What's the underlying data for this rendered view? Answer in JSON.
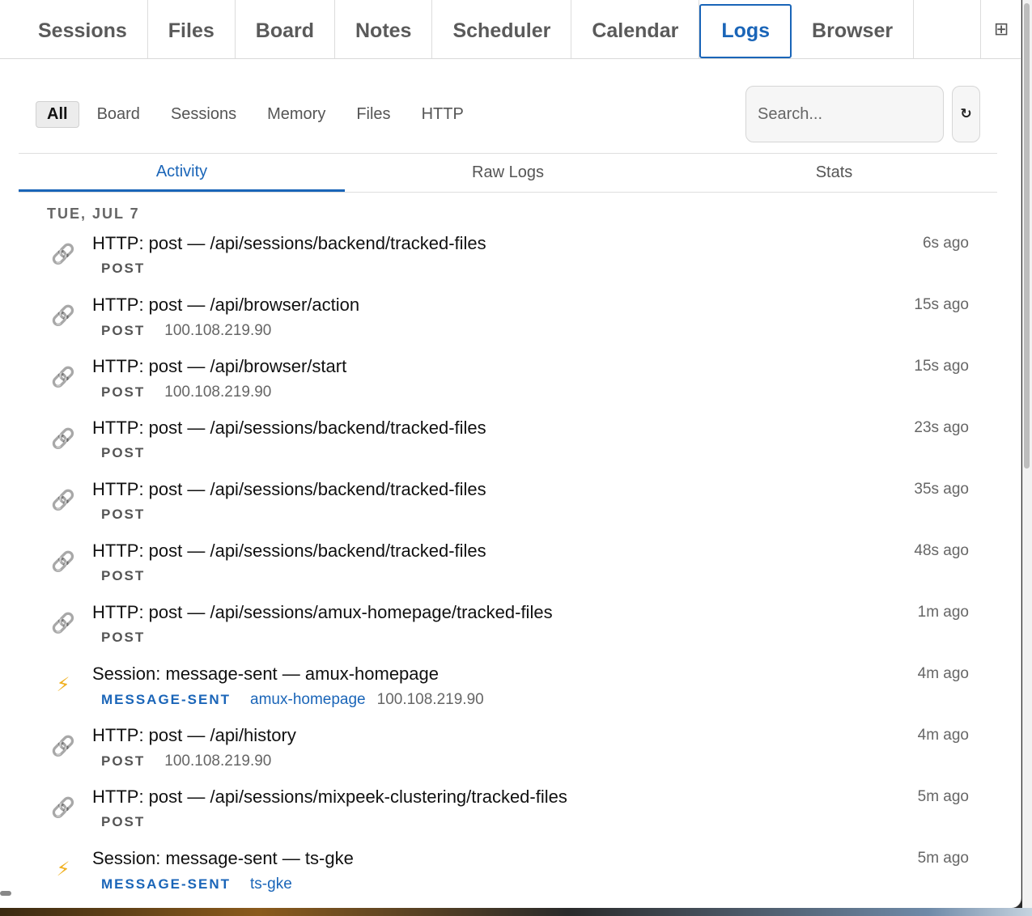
{
  "tabs": [
    {
      "label": "Sessions",
      "active": false
    },
    {
      "label": "Files",
      "active": false
    },
    {
      "label": "Board",
      "active": false
    },
    {
      "label": "Notes",
      "active": false
    },
    {
      "label": "Scheduler",
      "active": false
    },
    {
      "label": "Calendar",
      "active": false
    },
    {
      "label": "Logs",
      "active": true
    },
    {
      "label": "Browser",
      "active": false
    }
  ],
  "grid_icon": "⊞",
  "filters": [
    {
      "label": "All",
      "active": true
    },
    {
      "label": "Board",
      "active": false
    },
    {
      "label": "Sessions",
      "active": false
    },
    {
      "label": "Memory",
      "active": false
    },
    {
      "label": "Files",
      "active": false
    },
    {
      "label": "HTTP",
      "active": false
    }
  ],
  "search": {
    "placeholder": "Search..."
  },
  "refresh_icon": "↻",
  "subtabs": [
    {
      "label": "Activity",
      "active": true
    },
    {
      "label": "Raw Logs",
      "active": false
    },
    {
      "label": "Stats",
      "active": false
    }
  ],
  "date_heading": "TUE, JUL 7",
  "entries": [
    {
      "icon": "link-icon",
      "title": "HTTP: post — /api/sessions/backend/tracked-files",
      "badge": "POST",
      "session": "",
      "ip": "",
      "time": "6s ago"
    },
    {
      "icon": "link-icon",
      "title": "HTTP: post — /api/browser/action",
      "badge": "POST",
      "session": "",
      "ip": "100.108.219.90",
      "time": "15s ago"
    },
    {
      "icon": "link-icon",
      "title": "HTTP: post — /api/browser/start",
      "badge": "POST",
      "session": "",
      "ip": "100.108.219.90",
      "time": "15s ago"
    },
    {
      "icon": "link-icon",
      "title": "HTTP: post — /api/sessions/backend/tracked-files",
      "badge": "POST",
      "session": "",
      "ip": "",
      "time": "23s ago"
    },
    {
      "icon": "link-icon",
      "title": "HTTP: post — /api/sessions/backend/tracked-files",
      "badge": "POST",
      "session": "",
      "ip": "",
      "time": "35s ago"
    },
    {
      "icon": "link-icon",
      "title": "HTTP: post — /api/sessions/backend/tracked-files",
      "badge": "POST",
      "session": "",
      "ip": "",
      "time": "48s ago"
    },
    {
      "icon": "link-icon",
      "title": "HTTP: post — /api/sessions/amux-homepage/tracked-files",
      "badge": "POST",
      "session": "",
      "ip": "",
      "time": "1m ago"
    },
    {
      "icon": "bolt-icon",
      "title": "Session: message-sent — amux-homepage",
      "badge": "MESSAGE-SENT",
      "session": "amux-homepage",
      "ip": "100.108.219.90",
      "time": "4m ago"
    },
    {
      "icon": "link-icon",
      "title": "HTTP: post — /api/history",
      "badge": "POST",
      "session": "",
      "ip": "100.108.219.90",
      "time": "4m ago"
    },
    {
      "icon": "link-icon",
      "title": "HTTP: post — /api/sessions/mixpeek-clustering/tracked-files",
      "badge": "POST",
      "session": "",
      "ip": "",
      "time": "5m ago"
    },
    {
      "icon": "bolt-icon",
      "title": "Session: message-sent — ts-gke",
      "badge": "MESSAGE-SENT",
      "session": "ts-gke",
      "ip": "",
      "time": "5m ago"
    }
  ],
  "colors": {
    "accent": "#1a65b8",
    "bolt": "#f0b020"
  }
}
